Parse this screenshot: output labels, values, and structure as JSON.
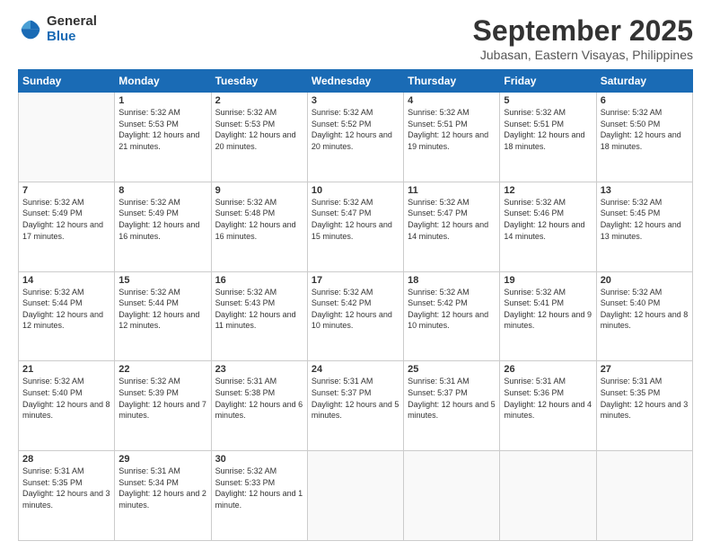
{
  "logo": {
    "general": "General",
    "blue": "Blue"
  },
  "header": {
    "month": "September 2025",
    "location": "Jubasan, Eastern Visayas, Philippines"
  },
  "weekdays": [
    "Sunday",
    "Monday",
    "Tuesday",
    "Wednesday",
    "Thursday",
    "Friday",
    "Saturday"
  ],
  "weeks": [
    [
      {
        "day": "",
        "sunrise": "",
        "sunset": "",
        "daylight": ""
      },
      {
        "day": "1",
        "sunrise": "Sunrise: 5:32 AM",
        "sunset": "Sunset: 5:53 PM",
        "daylight": "Daylight: 12 hours and 21 minutes."
      },
      {
        "day": "2",
        "sunrise": "Sunrise: 5:32 AM",
        "sunset": "Sunset: 5:53 PM",
        "daylight": "Daylight: 12 hours and 20 minutes."
      },
      {
        "day": "3",
        "sunrise": "Sunrise: 5:32 AM",
        "sunset": "Sunset: 5:52 PM",
        "daylight": "Daylight: 12 hours and 20 minutes."
      },
      {
        "day": "4",
        "sunrise": "Sunrise: 5:32 AM",
        "sunset": "Sunset: 5:51 PM",
        "daylight": "Daylight: 12 hours and 19 minutes."
      },
      {
        "day": "5",
        "sunrise": "Sunrise: 5:32 AM",
        "sunset": "Sunset: 5:51 PM",
        "daylight": "Daylight: 12 hours and 18 minutes."
      },
      {
        "day": "6",
        "sunrise": "Sunrise: 5:32 AM",
        "sunset": "Sunset: 5:50 PM",
        "daylight": "Daylight: 12 hours and 18 minutes."
      }
    ],
    [
      {
        "day": "7",
        "sunrise": "Sunrise: 5:32 AM",
        "sunset": "Sunset: 5:49 PM",
        "daylight": "Daylight: 12 hours and 17 minutes."
      },
      {
        "day": "8",
        "sunrise": "Sunrise: 5:32 AM",
        "sunset": "Sunset: 5:49 PM",
        "daylight": "Daylight: 12 hours and 16 minutes."
      },
      {
        "day": "9",
        "sunrise": "Sunrise: 5:32 AM",
        "sunset": "Sunset: 5:48 PM",
        "daylight": "Daylight: 12 hours and 16 minutes."
      },
      {
        "day": "10",
        "sunrise": "Sunrise: 5:32 AM",
        "sunset": "Sunset: 5:47 PM",
        "daylight": "Daylight: 12 hours and 15 minutes."
      },
      {
        "day": "11",
        "sunrise": "Sunrise: 5:32 AM",
        "sunset": "Sunset: 5:47 PM",
        "daylight": "Daylight: 12 hours and 14 minutes."
      },
      {
        "day": "12",
        "sunrise": "Sunrise: 5:32 AM",
        "sunset": "Sunset: 5:46 PM",
        "daylight": "Daylight: 12 hours and 14 minutes."
      },
      {
        "day": "13",
        "sunrise": "Sunrise: 5:32 AM",
        "sunset": "Sunset: 5:45 PM",
        "daylight": "Daylight: 12 hours and 13 minutes."
      }
    ],
    [
      {
        "day": "14",
        "sunrise": "Sunrise: 5:32 AM",
        "sunset": "Sunset: 5:44 PM",
        "daylight": "Daylight: 12 hours and 12 minutes."
      },
      {
        "day": "15",
        "sunrise": "Sunrise: 5:32 AM",
        "sunset": "Sunset: 5:44 PM",
        "daylight": "Daylight: 12 hours and 12 minutes."
      },
      {
        "day": "16",
        "sunrise": "Sunrise: 5:32 AM",
        "sunset": "Sunset: 5:43 PM",
        "daylight": "Daylight: 12 hours and 11 minutes."
      },
      {
        "day": "17",
        "sunrise": "Sunrise: 5:32 AM",
        "sunset": "Sunset: 5:42 PM",
        "daylight": "Daylight: 12 hours and 10 minutes."
      },
      {
        "day": "18",
        "sunrise": "Sunrise: 5:32 AM",
        "sunset": "Sunset: 5:42 PM",
        "daylight": "Daylight: 12 hours and 10 minutes."
      },
      {
        "day": "19",
        "sunrise": "Sunrise: 5:32 AM",
        "sunset": "Sunset: 5:41 PM",
        "daylight": "Daylight: 12 hours and 9 minutes."
      },
      {
        "day": "20",
        "sunrise": "Sunrise: 5:32 AM",
        "sunset": "Sunset: 5:40 PM",
        "daylight": "Daylight: 12 hours and 8 minutes."
      }
    ],
    [
      {
        "day": "21",
        "sunrise": "Sunrise: 5:32 AM",
        "sunset": "Sunset: 5:40 PM",
        "daylight": "Daylight: 12 hours and 8 minutes."
      },
      {
        "day": "22",
        "sunrise": "Sunrise: 5:32 AM",
        "sunset": "Sunset: 5:39 PM",
        "daylight": "Daylight: 12 hours and 7 minutes."
      },
      {
        "day": "23",
        "sunrise": "Sunrise: 5:31 AM",
        "sunset": "Sunset: 5:38 PM",
        "daylight": "Daylight: 12 hours and 6 minutes."
      },
      {
        "day": "24",
        "sunrise": "Sunrise: 5:31 AM",
        "sunset": "Sunset: 5:37 PM",
        "daylight": "Daylight: 12 hours and 5 minutes."
      },
      {
        "day": "25",
        "sunrise": "Sunrise: 5:31 AM",
        "sunset": "Sunset: 5:37 PM",
        "daylight": "Daylight: 12 hours and 5 minutes."
      },
      {
        "day": "26",
        "sunrise": "Sunrise: 5:31 AM",
        "sunset": "Sunset: 5:36 PM",
        "daylight": "Daylight: 12 hours and 4 minutes."
      },
      {
        "day": "27",
        "sunrise": "Sunrise: 5:31 AM",
        "sunset": "Sunset: 5:35 PM",
        "daylight": "Daylight: 12 hours and 3 minutes."
      }
    ],
    [
      {
        "day": "28",
        "sunrise": "Sunrise: 5:31 AM",
        "sunset": "Sunset: 5:35 PM",
        "daylight": "Daylight: 12 hours and 3 minutes."
      },
      {
        "day": "29",
        "sunrise": "Sunrise: 5:31 AM",
        "sunset": "Sunset: 5:34 PM",
        "daylight": "Daylight: 12 hours and 2 minutes."
      },
      {
        "day": "30",
        "sunrise": "Sunrise: 5:32 AM",
        "sunset": "Sunset: 5:33 PM",
        "daylight": "Daylight: 12 hours and 1 minute."
      },
      {
        "day": "",
        "sunrise": "",
        "sunset": "",
        "daylight": ""
      },
      {
        "day": "",
        "sunrise": "",
        "sunset": "",
        "daylight": ""
      },
      {
        "day": "",
        "sunrise": "",
        "sunset": "",
        "daylight": ""
      },
      {
        "day": "",
        "sunrise": "",
        "sunset": "",
        "daylight": ""
      }
    ]
  ]
}
